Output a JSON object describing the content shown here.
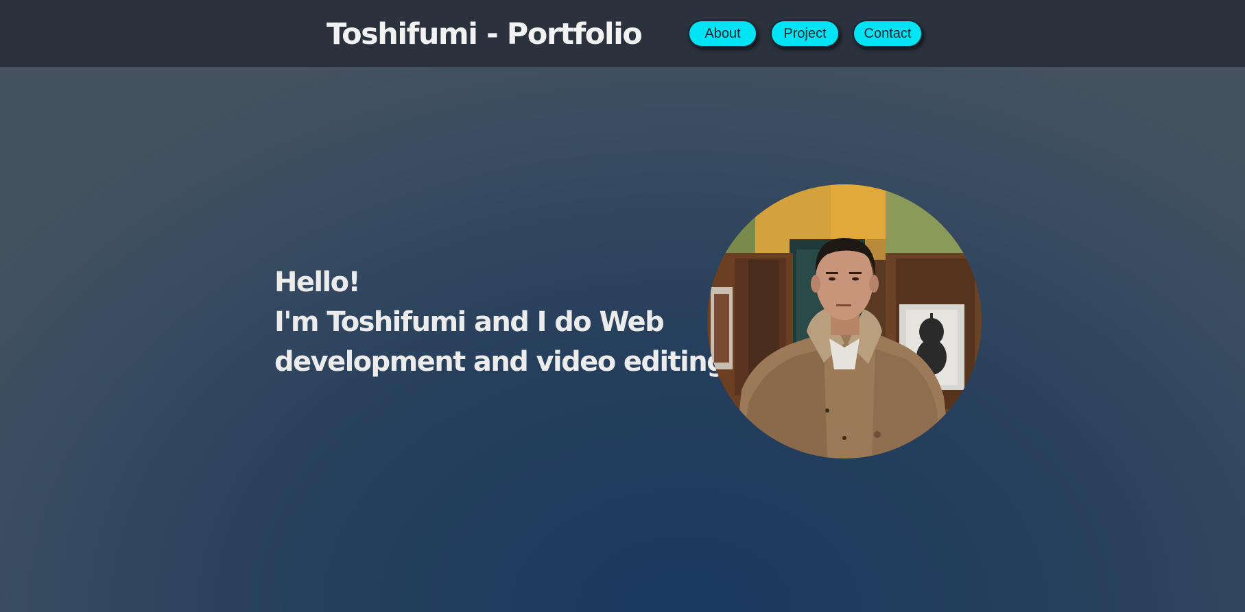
{
  "header": {
    "title": "Toshifumi - Portfolio",
    "nav": {
      "about": "About",
      "project": "Project",
      "contact": "Contact"
    }
  },
  "hero": {
    "greeting": "Hello!",
    "line1": "I'm Toshifumi and I do Web",
    "line2": "development and video editing."
  },
  "colors": {
    "nav_button": "#00e4f6",
    "navbar": "#2a333d",
    "text": "#ececec"
  }
}
